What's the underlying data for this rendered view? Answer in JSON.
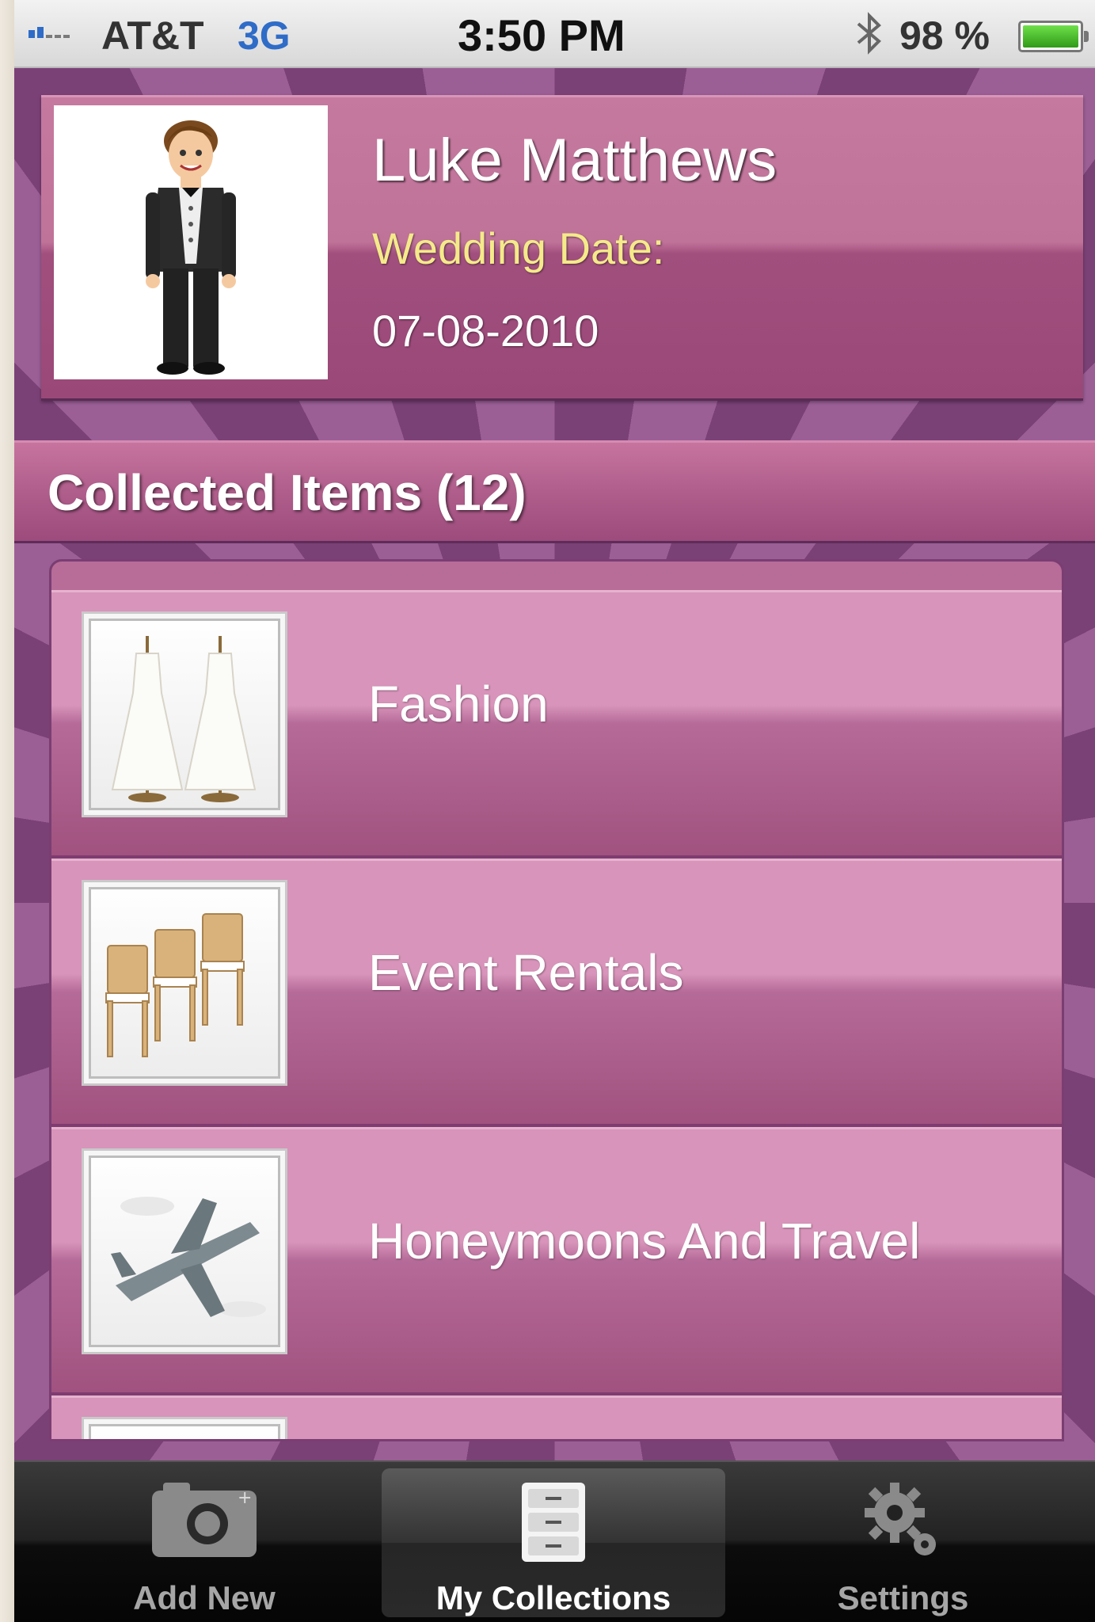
{
  "status_bar": {
    "carrier": "AT&T",
    "network": "3G",
    "time": "3:50 PM",
    "battery_percent": "98 %",
    "battery_level": 0.98,
    "bluetooth_icon": "bluetooth-icon"
  },
  "profile": {
    "name": "Luke Matthews",
    "wedding_label": "Wedding Date:",
    "wedding_date": "07-08-2010",
    "avatar_icon": "groom-avatar"
  },
  "collection": {
    "title": "Collected Items (12)",
    "items": [
      {
        "label": "Fashion",
        "icon": "wedding-dresses-icon"
      },
      {
        "label": "Event Rentals",
        "icon": "chairs-icon"
      },
      {
        "label": "Honeymoons And Travel",
        "icon": "airplane-icon"
      },
      {
        "label": "",
        "icon": "partially-visible-item-icon"
      }
    ]
  },
  "tabbar": {
    "tabs": [
      {
        "label": "Add New",
        "icon": "camera-icon",
        "active": false
      },
      {
        "label": "My Collections",
        "icon": "cabinet-icon",
        "active": true
      },
      {
        "label": "Settings",
        "icon": "gears-icon",
        "active": false
      }
    ]
  },
  "colors": {
    "background_purple": "#7a4177",
    "card_pink": "#c5799f",
    "wedding_label_yellow": "#f4ea8a",
    "status_blue": "#2f6cc8"
  }
}
